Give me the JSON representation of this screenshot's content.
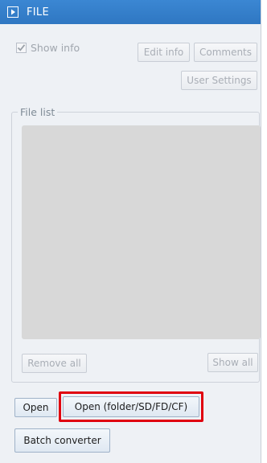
{
  "window": {
    "title": "FILE",
    "icon": "play-icon"
  },
  "options": {
    "show_info_label": "Show info",
    "show_info_checked": true
  },
  "top_buttons": {
    "edit_info": "Edit info",
    "comments": "Comments",
    "user_settings": "User Settings"
  },
  "file_list": {
    "label": "File list",
    "remove_all": "Remove all",
    "show_all": "Show all"
  },
  "bottom_buttons": {
    "open": "Open",
    "open_folder": "Open (folder/SD/FD/CF)",
    "batch_converter": "Batch converter"
  },
  "colors": {
    "titlebar": "#3b87d3",
    "highlight_border": "#e0000f"
  }
}
